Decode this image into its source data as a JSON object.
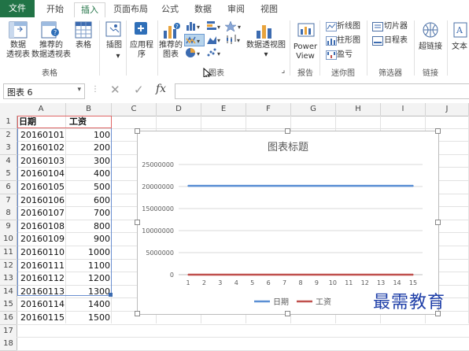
{
  "ribbon_tabs": [
    "文件",
    "开始",
    "插入",
    "页面布局",
    "公式",
    "数据",
    "审阅",
    "视图"
  ],
  "ribbon": {
    "pivot_table": [
      "数据",
      "透视表"
    ],
    "recommended_pivot": [
      "推荐的",
      "数据透视表"
    ],
    "table": "表格",
    "group_tables": "表格",
    "illustrations": "插图",
    "apps": [
      "应用程",
      "序"
    ],
    "recommended_charts": [
      "推荐的",
      "图表"
    ],
    "pivot_chart": "数据透视图",
    "group_charts": "图表",
    "power_view": [
      "Power",
      "View"
    ],
    "group_reports": "报告",
    "spark_line": "折线图",
    "spark_column": "柱形图",
    "spark_winloss": "盈亏",
    "group_sparklines": "迷你图",
    "slicer": "切片器",
    "timeline": "日程表",
    "group_filters": "筛选器",
    "hyperlink": "超链接",
    "group_links": "链接",
    "text": "文本"
  },
  "formula_bar": {
    "name_box": "图表 6",
    "cancel_glyph": "✕",
    "enter_glyph": "✓",
    "fx_label": "fx",
    "content": ""
  },
  "columns": [
    "A",
    "B",
    "C",
    "D",
    "E",
    "F",
    "G",
    "H",
    "I",
    "J"
  ],
  "rows": [
    "1",
    "2",
    "3",
    "4",
    "5",
    "6",
    "7",
    "8",
    "9",
    "10",
    "11",
    "12",
    "13",
    "14",
    "15",
    "16",
    "17",
    "18"
  ],
  "sheet": {
    "header": [
      "日期",
      "工资"
    ],
    "data": [
      [
        "20160101",
        "100"
      ],
      [
        "20160102",
        "200"
      ],
      [
        "20160103",
        "300"
      ],
      [
        "20160104",
        "400"
      ],
      [
        "20160105",
        "500"
      ],
      [
        "20160106",
        "600"
      ],
      [
        "20160107",
        "700"
      ],
      [
        "20160108",
        "800"
      ],
      [
        "20160109",
        "900"
      ],
      [
        "20160110",
        "1000"
      ],
      [
        "20160111",
        "1100"
      ],
      [
        "20160112",
        "1200"
      ],
      [
        "20160113",
        "1300"
      ],
      [
        "20160114",
        "1400"
      ],
      [
        "20160115",
        "1500"
      ]
    ]
  },
  "colors": {
    "excel_green": "#217346",
    "series_date": "#5b8fd4",
    "series_wage": "#c0504d",
    "watermark": "#1f3fa8"
  },
  "chart_data": {
    "type": "line",
    "title": "图表标题",
    "categories": [
      "1",
      "2",
      "3",
      "4",
      "5",
      "6",
      "7",
      "8",
      "9",
      "10",
      "11",
      "12",
      "13",
      "14",
      "15"
    ],
    "series": [
      {
        "name": "日期",
        "values": [
          20160101,
          20160102,
          20160103,
          20160104,
          20160105,
          20160106,
          20160107,
          20160108,
          20160109,
          20160110,
          20160111,
          20160112,
          20160113,
          20160114,
          20160115
        ]
      },
      {
        "name": "工资",
        "values": [
          100,
          200,
          300,
          400,
          500,
          600,
          700,
          800,
          900,
          1000,
          1100,
          1200,
          1300,
          1400,
          1500
        ]
      }
    ],
    "yticks": [
      "25000000",
      "20000000",
      "15000000",
      "10000000",
      "5000000",
      "0"
    ],
    "ylim": [
      0,
      25000000
    ],
    "legend": "bottom",
    "grid": true
  },
  "watermark": "最需教育"
}
